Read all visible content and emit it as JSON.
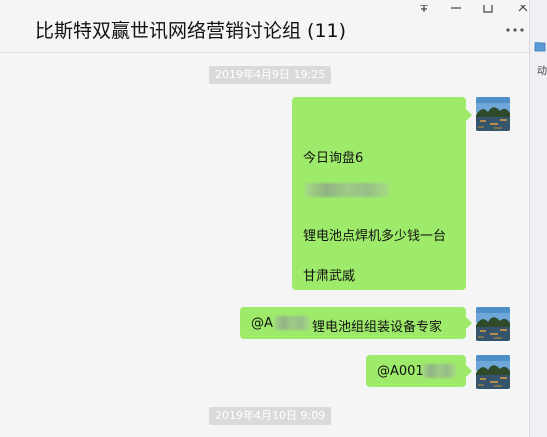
{
  "chat": {
    "title": "比斯特双赢世讯网络营销讨论组 (11)"
  },
  "window_controls": {
    "pin_glyph": "ネ",
    "minimize_glyph": "—",
    "maximize_glyph": "☐",
    "close_glyph": "✕"
  },
  "side_panel": {
    "partial_text": "动"
  },
  "timestamps": [
    "2019年4月9日 19:25",
    "2019年4月10日 9:09"
  ],
  "messages": [
    {
      "sender": "self",
      "lines": [
        "今日询盘6",
        "锂电池点焊机多少钱一台",
        "甘肃武威"
      ]
    },
    {
      "sender": "self",
      "prefix": "@A",
      "suffix": "锂电池组组装设备专家"
    },
    {
      "sender": "self",
      "prefix": "@A001",
      "suffix": ""
    }
  ],
  "colors": {
    "bubble_self": "#9eea6a",
    "background": "#f5f5f5",
    "timestamp_bg": "#dadada"
  },
  "icons": {
    "more": "more-dots-icon",
    "avatar": "landscape-avatar-icon"
  }
}
